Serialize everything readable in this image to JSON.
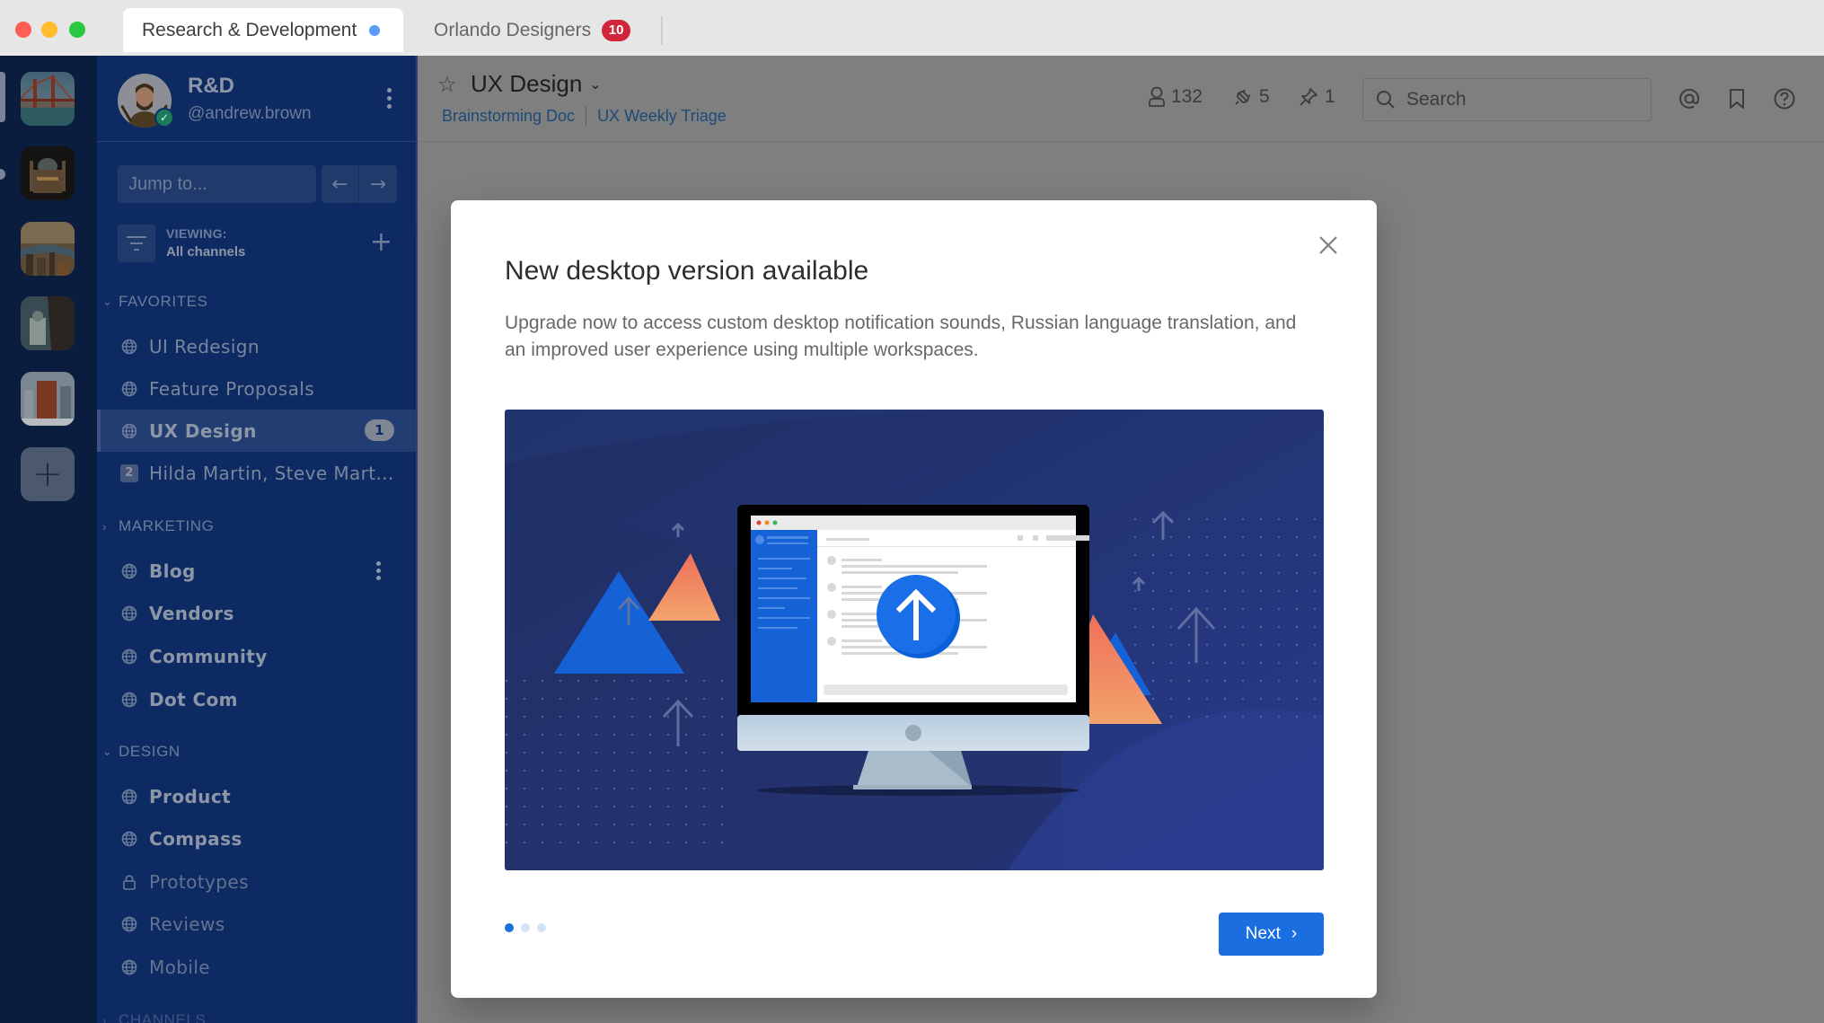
{
  "tabs": [
    {
      "label": "Research & Development",
      "active": true,
      "unread_dot": true
    },
    {
      "label": "Orlando Designers",
      "active": false,
      "badge": "10"
    }
  ],
  "colors": {
    "accent": "#1a6ee0",
    "sidebar_bg": "#0e2a63",
    "team_sidebar_bg": "#0a1d3f",
    "badge_red": "#d0253a",
    "online": "#1d7a5b"
  },
  "team_sidebar": {
    "teams": [
      {
        "name": "team-golden-gate",
        "active": true
      },
      {
        "name": "team-cathedral"
      },
      {
        "name": "team-city-sunset"
      },
      {
        "name": "team-street"
      },
      {
        "name": "team-flatiron"
      }
    ],
    "add_label": "+"
  },
  "sidebar": {
    "team_name": "R&D",
    "username": "@andrew.brown",
    "jump_placeholder": "Jump to...",
    "viewing_label": "VIEWING:",
    "viewing_value": "All channels",
    "sections": [
      {
        "title": "FAVORITES",
        "expanded": true,
        "items": [
          {
            "label": "UI Redesign",
            "icon": "globe-icon"
          },
          {
            "label": "Feature Proposals",
            "icon": "globe-icon"
          },
          {
            "label": "UX Design",
            "icon": "globe-icon",
            "active": true,
            "badge": "1"
          },
          {
            "label": "Hilda Martin, Steve Mart...",
            "icon": "group-dm-icon",
            "dm_count": "2"
          }
        ]
      },
      {
        "title": "MARKETING",
        "expanded": false,
        "items": [
          {
            "label": "Blog",
            "icon": "globe-icon",
            "unread": true
          },
          {
            "label": "Vendors",
            "icon": "globe-icon",
            "unread": true
          },
          {
            "label": "Community",
            "icon": "globe-icon",
            "unread": true
          },
          {
            "label": "Dot Com",
            "icon": "globe-icon",
            "unread": true
          }
        ]
      },
      {
        "title": "DESIGN",
        "expanded": true,
        "items": [
          {
            "label": "Product",
            "icon": "globe-icon",
            "unread": true
          },
          {
            "label": "Compass",
            "icon": "globe-icon",
            "unread": true
          },
          {
            "label": "Prototypes",
            "icon": "lock-icon"
          },
          {
            "label": "Reviews",
            "icon": "globe-icon"
          },
          {
            "label": "Mobile",
            "icon": "globe-icon"
          }
        ]
      },
      {
        "title": "CHANNELS",
        "expanded": false,
        "items": []
      }
    ]
  },
  "channel_header": {
    "title": "UX Design",
    "links": [
      "Brainstorming Doc",
      "UX Weekly Triage"
    ],
    "members": "132",
    "pinned_apps": "5",
    "pinned": "1",
    "search_placeholder": "Search"
  },
  "modal": {
    "title": "New desktop version available",
    "body": "Upgrade now to access custom desktop notification sounds, Russian language translation, and an improved user experience using multiple workspaces.",
    "illustration": "desktop-upgrade-illustration",
    "page": 1,
    "page_count": 3,
    "next_label": "Next"
  }
}
